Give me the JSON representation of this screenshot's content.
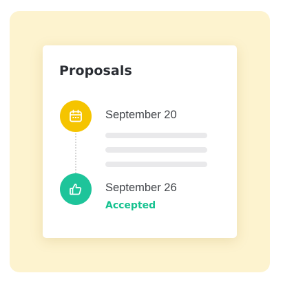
{
  "card": {
    "title": "Proposals"
  },
  "timeline": [
    {
      "icon": "calendar-icon",
      "date": "September 20",
      "placeholder_lines": 3,
      "color": "#f5c400"
    },
    {
      "icon": "thumbs-up-icon",
      "date": "September 26",
      "status": "Accepted",
      "color": "#1ec49a"
    }
  ],
  "colors": {
    "backdrop": "#fdf3cf",
    "status_accepted": "#16c290"
  }
}
